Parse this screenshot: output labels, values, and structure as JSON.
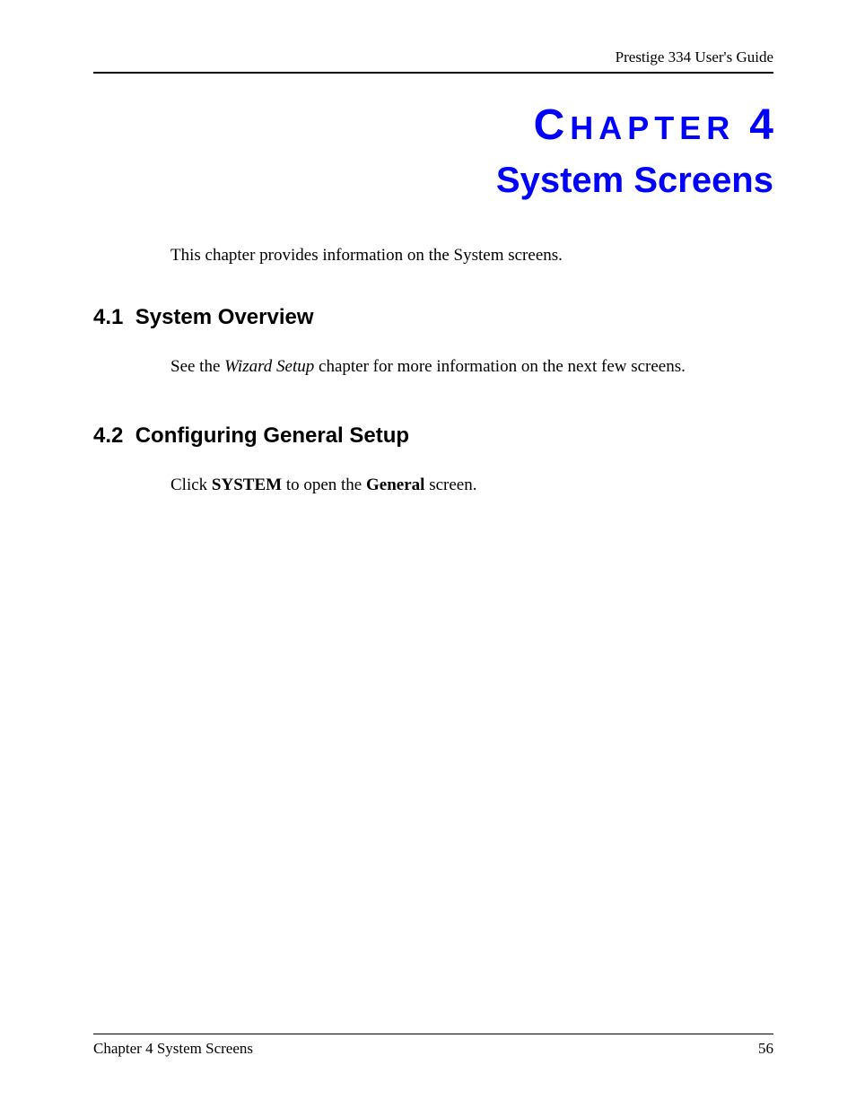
{
  "header": {
    "guide_name": "Prestige 334 User's Guide"
  },
  "chapter": {
    "label_cap": "C",
    "label_rest": "HAPTER",
    "number": "4",
    "title": "System Screens",
    "intro": "This chapter provides information on the System screens."
  },
  "sections": [
    {
      "number": "4.1",
      "title": "System Overview",
      "para_pre": "See the ",
      "para_italic": "Wizard Setup",
      "para_post": " chapter for more information on the next few screens."
    },
    {
      "number": "4.2",
      "title": "Configuring General Setup",
      "para_pre": "Click ",
      "para_bold1": "SYSTEM",
      "para_mid": " to open the ",
      "para_bold2": "General",
      "para_post": " screen."
    }
  ],
  "footer": {
    "left": "Chapter 4 System Screens",
    "right": "56"
  }
}
